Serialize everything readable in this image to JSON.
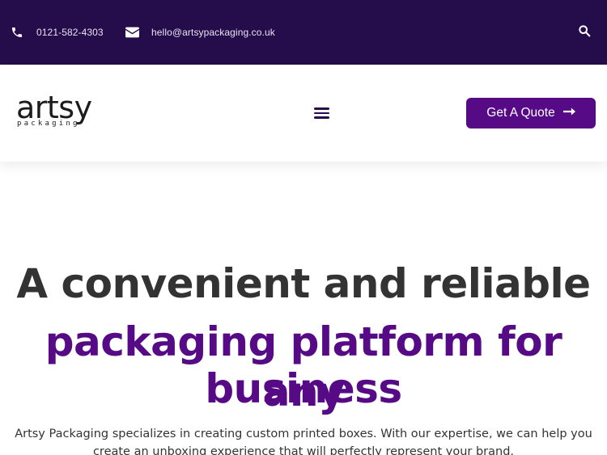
{
  "topbar": {
    "phone": "0121-582-4303",
    "email": "hello@artsypackaging.co.uk",
    "icons": {
      "phone": "phone-icon",
      "email": "envelope-icon",
      "search": "search-icon"
    },
    "background": "#250c4a"
  },
  "header": {
    "logo_word": "artsy",
    "logo_sub": "packaging",
    "menu_icon": "hamburger-menu-icon",
    "quote_label": "Get A Quote",
    "quote_icon": "arrow-right-icon",
    "accent": "#560a86"
  },
  "hero": {
    "line1": "A convenient and reliable",
    "line2": "packaging platform for any",
    "line3": "business",
    "description_line1": "Artsy Packaging specializes in creating custom printed boxes. With our expertise, we can help you",
    "description_line2": "create an unboxing experience that will perfectly represent your brand."
  }
}
